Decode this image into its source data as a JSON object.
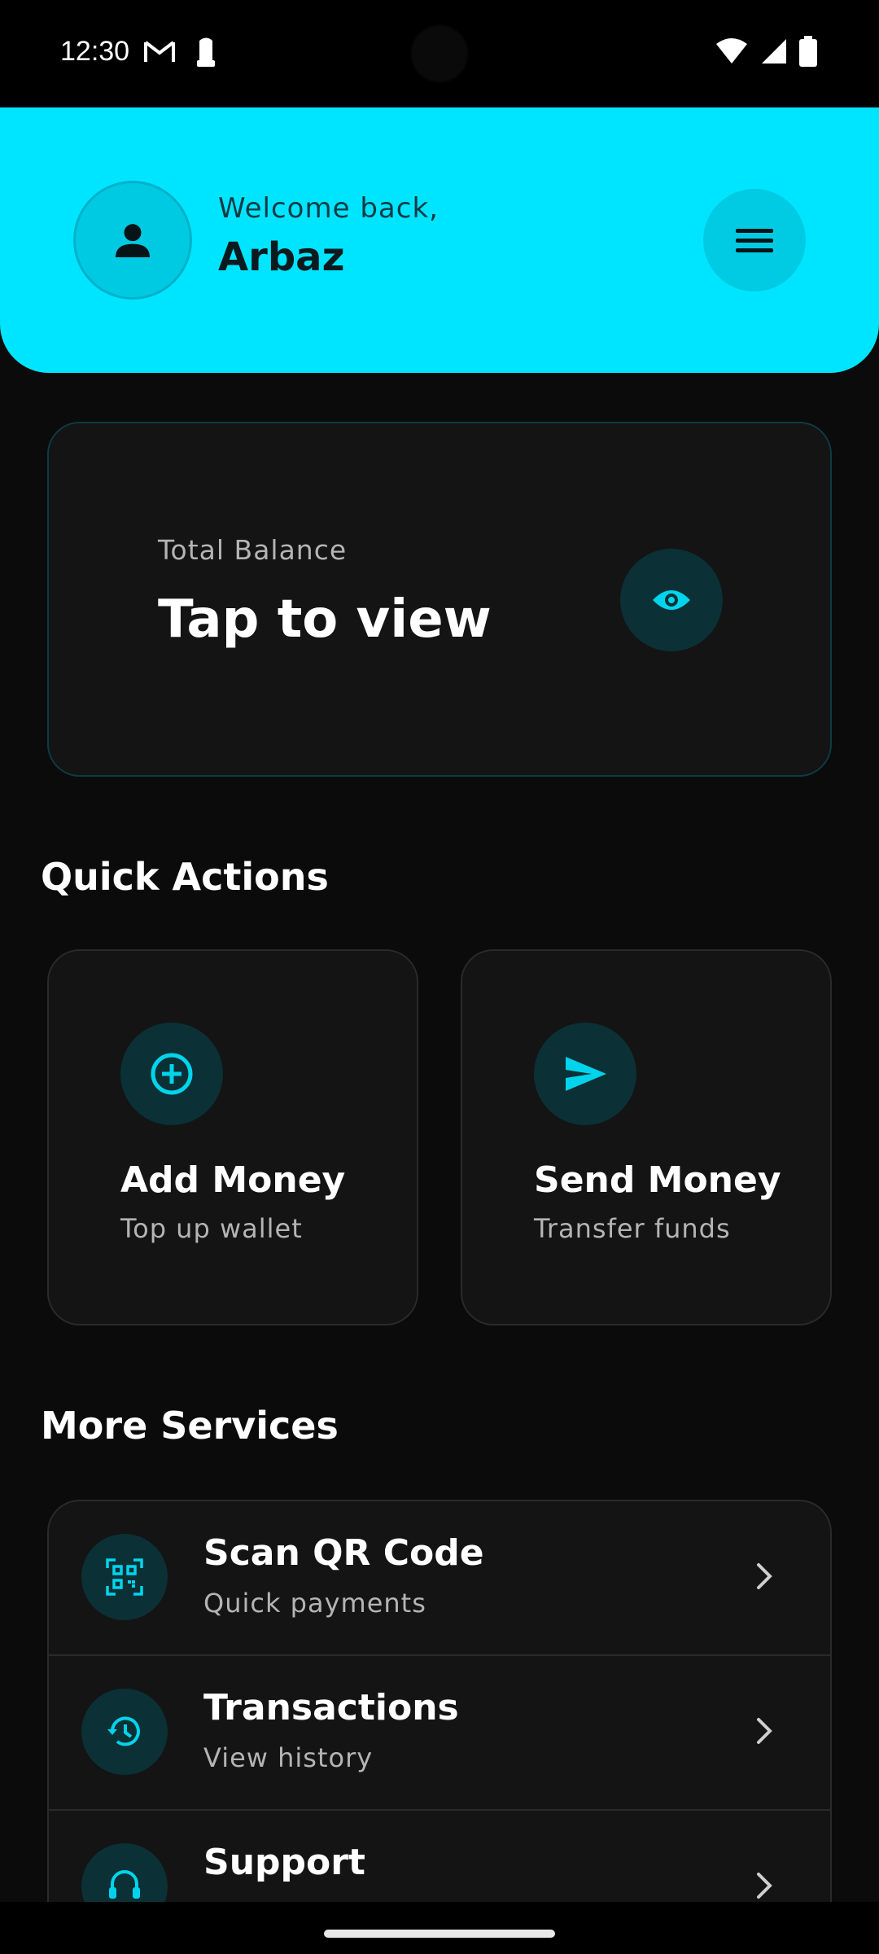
{
  "status": {
    "time": "12:30",
    "icons": [
      "gmail-icon",
      "notification-icon",
      "wifi-icon",
      "signal-icon",
      "battery-icon"
    ]
  },
  "header": {
    "welcome": "Welcome back,",
    "username": "Arbaz",
    "avatar_icon": "person-icon",
    "menu_icon": "hamburger-menu-icon"
  },
  "balance": {
    "label": "Total Balance",
    "value": "Tap to view",
    "icon": "eye-icon"
  },
  "quick_actions": {
    "title": "Quick Actions",
    "items": [
      {
        "title": "Add Money",
        "subtitle": "Top up wallet",
        "icon": "add-circle-icon"
      },
      {
        "title": "Send Money",
        "subtitle": "Transfer funds",
        "icon": "send-icon"
      }
    ]
  },
  "more_services": {
    "title": "More Services",
    "items": [
      {
        "title": "Scan QR Code",
        "subtitle": "Quick payments",
        "icon": "qr-code-icon"
      },
      {
        "title": "Transactions",
        "subtitle": "View history",
        "icon": "history-icon"
      },
      {
        "title": "Support",
        "subtitle": "",
        "icon": "headset-icon"
      }
    ]
  },
  "colors": {
    "accent": "#00e5ff",
    "background": "#0b0b0b",
    "card": "#141414",
    "icon_bg": "#0b3035"
  }
}
